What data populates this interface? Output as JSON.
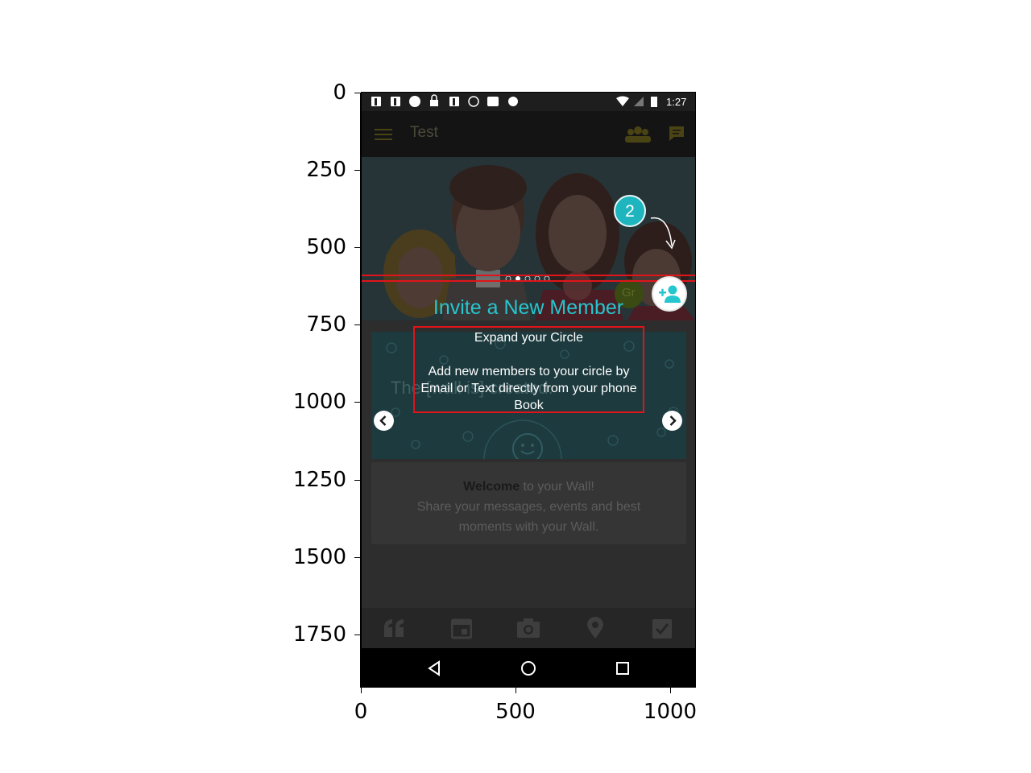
{
  "axes": {
    "y_ticks": [
      "0",
      "250",
      "500",
      "750",
      "1000",
      "1250",
      "1500",
      "1750"
    ],
    "x_ticks": [
      "0",
      "500",
      "1000"
    ]
  },
  "status_bar": {
    "time": "1:27"
  },
  "app_bar": {
    "title": "Test"
  },
  "hero": {
    "partial_label": "Gr"
  },
  "tooltip": {
    "step_number": "2",
    "title": "Invite a New Member",
    "subtitle": "Expand your Circle",
    "description": "Add new members to your circle by Email or Text directly from your phone Book"
  },
  "wall_banner": {
    "text": "The [wall is] created."
  },
  "welcome": {
    "bold": "Welcome",
    "rest": " to your Wall!",
    "line2": "Share your messages, events and best",
    "line3": "moments with your Wall."
  },
  "colors": {
    "accent": "#26c6cf",
    "highlight": "#e0141a",
    "app_icon": "#c8a600"
  },
  "icons": {
    "toolbar": [
      "quote-icon",
      "calendar-icon",
      "camera-icon",
      "location-icon",
      "checklist-icon"
    ],
    "nav": [
      "back-icon",
      "home-icon",
      "recents-icon"
    ]
  }
}
